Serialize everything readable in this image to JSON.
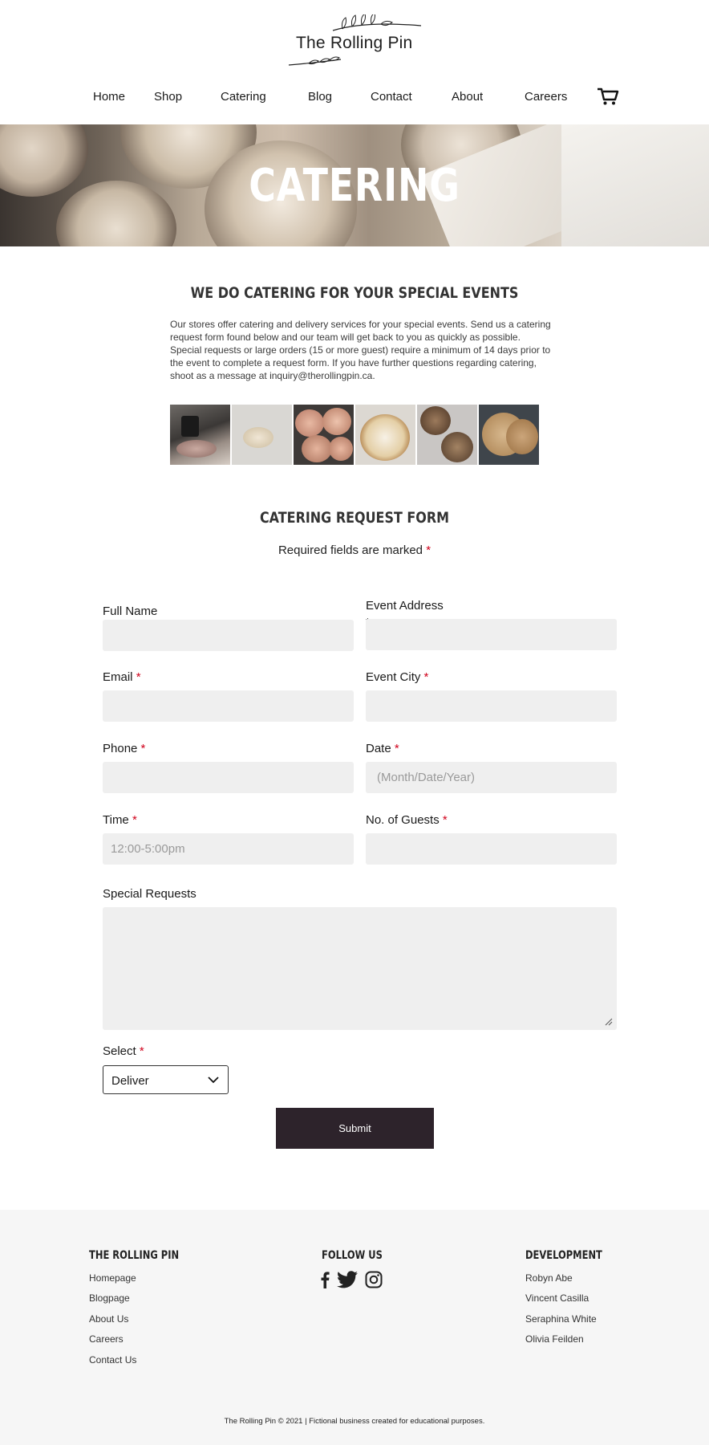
{
  "brand": {
    "name": "The Rolling Pin"
  },
  "nav": {
    "items": [
      "Home",
      "Shop",
      "Catering",
      "Blog",
      "Contact",
      "About",
      "Careers"
    ],
    "cart_icon": "shopping-cart-icon"
  },
  "hero": {
    "title": "CATERING"
  },
  "intro": {
    "title": "WE DO CATERING FOR YOUR SPECIAL EVENTS",
    "text": "Our stores offer catering and delivery services for your special events. Send us a catering request form found below and our team will get back to you as quickly as possible. Special requests or large orders (15 or more guest) require a minimum of 14 days prior to the event to complete a request form. If you have further questions regarding catering, shoot as a message at inquiry@therollingpin.ca."
  },
  "form": {
    "title": "CATERING REQUEST FORM",
    "subtitle": "Required fields are marked",
    "required_mark": "*",
    "fields": {
      "full_name": {
        "label": "Full Name",
        "value": ""
      },
      "event_address": {
        "label": "Event Address",
        "value": ""
      },
      "email": {
        "label": "Email",
        "value": ""
      },
      "event_city": {
        "label": "Event City",
        "value": ""
      },
      "phone": {
        "label": "Phone",
        "value": ""
      },
      "date": {
        "label": "Date",
        "placeholder": "(Month/Date/Year)"
      },
      "time": {
        "label": "Time",
        "placeholder": "12:00-5:00pm"
      },
      "guests": {
        "label": "No. of Guests",
        "value": ""
      },
      "special_requests": {
        "label": "Special Requests",
        "value": ""
      },
      "select": {
        "label": "Select",
        "value": "Deliver"
      }
    },
    "submit_label": "Submit"
  },
  "footer": {
    "col1": {
      "heading": "THE ROLLING PIN",
      "links": [
        "Homepage",
        "Blogpage",
        "About Us",
        "Careers",
        "Contact Us"
      ]
    },
    "col2": {
      "heading": "FOLLOW US",
      "icons": [
        "facebook-icon",
        "twitter-icon",
        "instagram-icon"
      ]
    },
    "col3": {
      "heading": "DEVELOPMENT",
      "names": [
        "Robyn Abe",
        "Vincent Casilla",
        "Seraphina White",
        "Olivia Feilden"
      ]
    },
    "copyright": "The Rolling Pin © 2021 | Fictional business created for educational purposes."
  },
  "colors": {
    "accent_dark": "#2d232b",
    "required": "#d0021b",
    "field_bg": "#efefef",
    "footer_bg": "#f6f6f6"
  }
}
